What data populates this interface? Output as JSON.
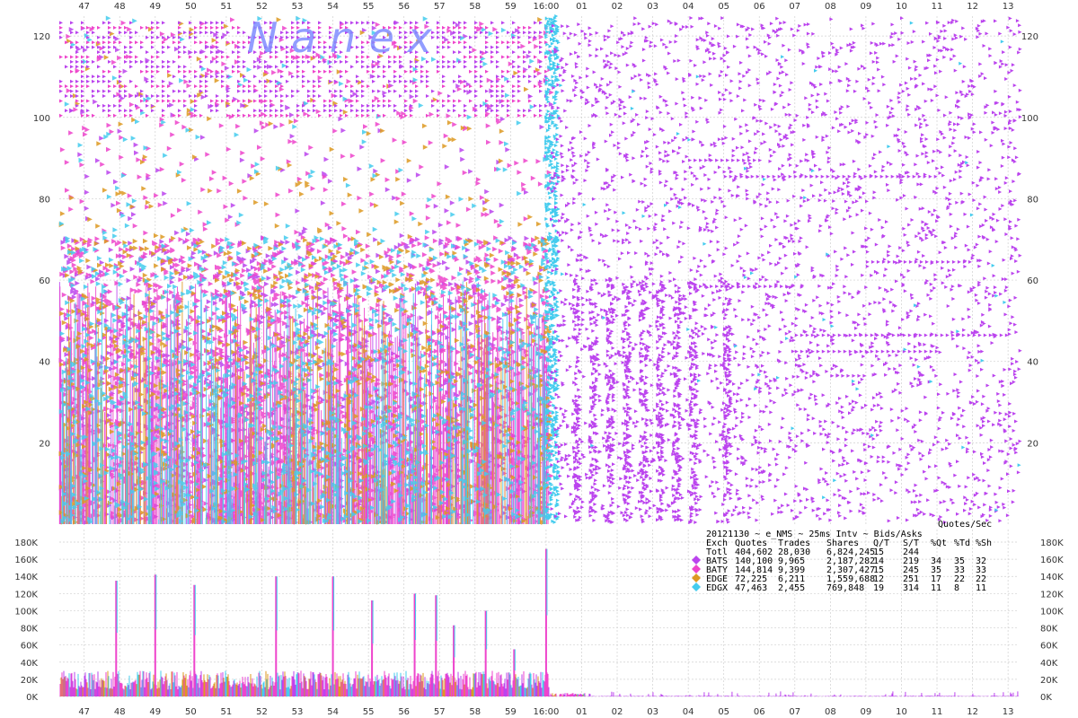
{
  "watermark": "N  a  n  e  x",
  "time_labels": [
    "47",
    "48",
    "49",
    "50",
    "51",
    "52",
    "53",
    "54",
    "55",
    "56",
    "57",
    "58",
    "59",
    "16:00",
    "01",
    "02",
    "03",
    "04",
    "05",
    "06",
    "07",
    "08",
    "09",
    "10",
    "11",
    "12",
    "13"
  ],
  "chart_data": [
    {
      "type": "scatter",
      "title": "",
      "xlabel": "",
      "ylabel": "",
      "x_ticks": [
        "47",
        "48",
        "49",
        "50",
        "51",
        "52",
        "53",
        "54",
        "55",
        "56",
        "57",
        "58",
        "59",
        "16:00",
        "01",
        "02",
        "03",
        "04",
        "05",
        "06",
        "07",
        "08",
        "09",
        "10",
        "11",
        "12",
        "13"
      ],
      "y_ticks": [
        20,
        40,
        60,
        80,
        100,
        120
      ],
      "ylim": [
        0,
        124
      ],
      "series_colors": {
        "BATS": "#bb44ee",
        "BATY": "#ee44cc",
        "EDGE": "#dd9922",
        "EDGX": "#44ccee"
      },
      "description_values": {
        "dense_until": "16:00",
        "sparse_after": "16:00"
      }
    },
    {
      "type": "bar",
      "title": "Quotes/Sec",
      "y_ticks": [
        "0K",
        "20K",
        "40K",
        "60K",
        "80K",
        "100K",
        "120K",
        "140K",
        "160K",
        "180K"
      ],
      "ylim": [
        0,
        180000
      ],
      "x_ticks": [
        "47",
        "48",
        "49",
        "50",
        "51",
        "52",
        "53",
        "54",
        "55",
        "56",
        "57",
        "58",
        "59",
        "16:00",
        "01",
        "02",
        "03",
        "04",
        "05",
        "06",
        "07",
        "08",
        "09",
        "10",
        "11",
        "12",
        "13"
      ],
      "spikes": [
        {
          "x": "47.9",
          "value": 135000
        },
        {
          "x": "49.0",
          "value": 142000
        },
        {
          "x": "50.1",
          "value": 130000
        },
        {
          "x": "52.4",
          "value": 140000
        },
        {
          "x": "54.0",
          "value": 140000
        },
        {
          "x": "55.1",
          "value": 112000
        },
        {
          "x": "56.3",
          "value": 120000
        },
        {
          "x": "56.9",
          "value": 118000
        },
        {
          "x": "57.4",
          "value": 83000
        },
        {
          "x": "58.3",
          "value": 100000
        },
        {
          "x": "59.1",
          "value": 55000
        },
        {
          "x": "16:00",
          "value": 172000
        }
      ]
    }
  ],
  "stats": {
    "header": "20121130 ~ e_NMS ~ 25ms Intv ~ Bids/Asks",
    "columns": [
      "Exch",
      "Quotes",
      "Trades",
      "Shares",
      "Q/T",
      "S/T",
      "%Qt",
      "%Td",
      "%Sh"
    ],
    "rows": [
      {
        "exch": "Totl",
        "quotes": "404,602",
        "trades": "28,030",
        "shares": "6,824,245",
        "qt": "15",
        "st": "244",
        "pqt": "",
        "ptd": "",
        "psh": "",
        "color": ""
      },
      {
        "exch": "BATS",
        "quotes": "140,100",
        "trades": "9,965",
        "shares": "2,187,282",
        "qt": "14",
        "st": "219",
        "pqt": "34",
        "ptd": "35",
        "psh": "32",
        "color": "#bb44ee"
      },
      {
        "exch": "BATY",
        "quotes": "144,814",
        "trades": "9,399",
        "shares": "2,307,427",
        "qt": "15",
        "st": "245",
        "pqt": "35",
        "ptd": "33",
        "psh": "33",
        "color": "#ee44cc"
      },
      {
        "exch": "EDGE",
        "quotes": "72,225",
        "trades": "6,211",
        "shares": "1,559,688",
        "qt": "12",
        "st": "251",
        "pqt": "17",
        "ptd": "22",
        "psh": "22",
        "color": "#dd9922"
      },
      {
        "exch": "EDGX",
        "quotes": "47,463",
        "trades": "2,455",
        "shares": "769,848",
        "qt": "19",
        "st": "314",
        "pqt": "11",
        "ptd": "8",
        "psh": "11",
        "color": "#44ccee"
      }
    ]
  }
}
